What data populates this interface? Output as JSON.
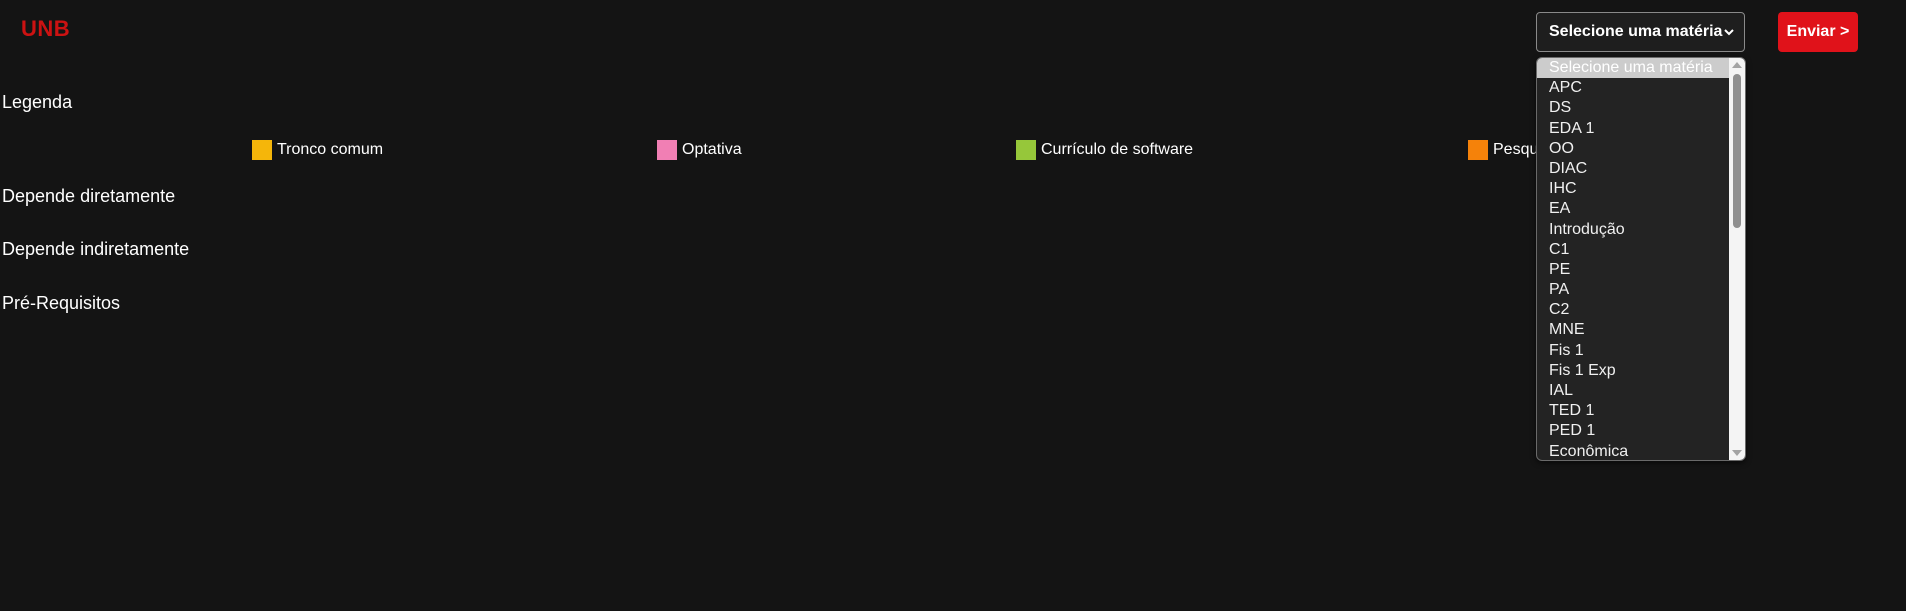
{
  "header": {
    "logo": "UNB",
    "select_value": "Selecione uma matéria",
    "send_label": "Enviar >"
  },
  "sections": {
    "legend_title": "Legenda",
    "depends_directly": "Depende diretamente",
    "depends_indirectly": "Depende indiretamente",
    "prerequisites": "Pré-Requisitos"
  },
  "legend": [
    {
      "label": "Tronco comum",
      "color": "#f5b60a"
    },
    {
      "label": "Optativa",
      "color": "#f17fb4"
    },
    {
      "label": "Currículo de software",
      "color": "#96c73a"
    },
    {
      "label": "Pesqu",
      "color": "#f5820a"
    }
  ],
  "dropdown": {
    "options": [
      "Selecione uma matéria",
      "APC",
      "DS",
      "EDA 1",
      "OO",
      "DIAC",
      "IHC",
      "EA",
      "Introdução",
      "C1",
      "PE",
      "PA",
      "C2",
      "MNE",
      "Fis 1",
      "Fis 1 Exp",
      "IAL",
      "TED 1",
      "PED 1",
      "Econômica"
    ]
  },
  "colors": {
    "background": "#141414",
    "brand": "#cc1212",
    "button": "#e0121a"
  }
}
